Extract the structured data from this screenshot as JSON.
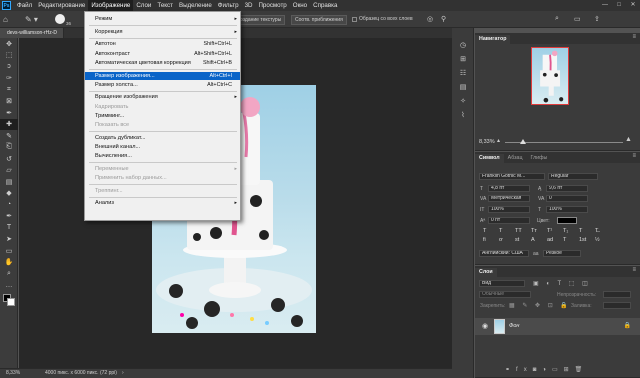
{
  "menubar": {
    "logo": "Ps",
    "items": [
      "Файл",
      "Редактирование",
      "Изображение",
      "Слои",
      "Текст",
      "Выделение",
      "Фильтр",
      "3D",
      "Просмотр",
      "Окно",
      "Справка"
    ],
    "active_index": 2,
    "window_controls": [
      "—",
      "□",
      "✕"
    ]
  },
  "options_bar": {
    "brush_size": "36",
    "texture_btn": "оздание текстуры",
    "proximity_btn": "Соотв. приближения",
    "sample_all_label": "Образец со всех слоев"
  },
  "document": {
    "tab_title": "devs-williamson-rHz-D"
  },
  "status": {
    "zoom": "8,33%",
    "doc_info": "4000 пикс. x 6000 пикс. (72 ppi)"
  },
  "image_menu": {
    "items": [
      {
        "label": "Режим",
        "shortcut": "",
        "submenu": true,
        "disabled": false,
        "highlight": false
      },
      {
        "label": "Коррекция",
        "shortcut": "",
        "submenu": true,
        "disabled": false,
        "highlight": false
      },
      {
        "label": "Автотон",
        "shortcut": "Shift+Ctrl+L",
        "submenu": false,
        "disabled": false,
        "highlight": false
      },
      {
        "label": "Автоконтраст",
        "shortcut": "Alt+Shift+Ctrl+L",
        "submenu": false,
        "disabled": false,
        "highlight": false
      },
      {
        "label": "Автоматическая цветовая коррекция",
        "shortcut": "Shift+Ctrl+B",
        "submenu": false,
        "disabled": false,
        "highlight": false
      },
      {
        "label": "Размер изображения...",
        "shortcut": "Alt+Ctrl+I",
        "submenu": false,
        "disabled": false,
        "highlight": true
      },
      {
        "label": "Размер холста...",
        "shortcut": "Alt+Ctrl+C",
        "submenu": false,
        "disabled": false,
        "highlight": false
      },
      {
        "label": "Вращение изображения",
        "shortcut": "",
        "submenu": true,
        "disabled": false,
        "highlight": false
      },
      {
        "label": "Кадрировать",
        "shortcut": "",
        "submenu": false,
        "disabled": true,
        "highlight": false
      },
      {
        "label": "Тримминг...",
        "shortcut": "",
        "submenu": false,
        "disabled": false,
        "highlight": false
      },
      {
        "label": "Показать все",
        "shortcut": "",
        "submenu": false,
        "disabled": true,
        "highlight": false
      },
      {
        "label": "Создать дубликат...",
        "shortcut": "",
        "submenu": false,
        "disabled": false,
        "highlight": false
      },
      {
        "label": "Внешний канал...",
        "shortcut": "",
        "submenu": false,
        "disabled": false,
        "highlight": false
      },
      {
        "label": "Вычисления...",
        "shortcut": "",
        "submenu": false,
        "disabled": false,
        "highlight": false
      },
      {
        "label": "Переменные",
        "shortcut": "",
        "submenu": true,
        "disabled": true,
        "highlight": false
      },
      {
        "label": "Применить набор данных...",
        "shortcut": "",
        "submenu": false,
        "disabled": true,
        "highlight": false
      },
      {
        "label": "Треппинг...",
        "shortcut": "",
        "submenu": false,
        "disabled": true,
        "highlight": false
      },
      {
        "label": "Анализ",
        "shortcut": "",
        "submenu": true,
        "disabled": false,
        "highlight": false
      }
    ]
  },
  "navigator": {
    "title": "Навигатор",
    "zoom": "8,33%"
  },
  "character": {
    "tabs": [
      "Символ",
      "Абзац",
      "Глифы"
    ],
    "font_family": "Franklin Gothic M...",
    "font_style": "Regular",
    "font_size": "4,8 пт",
    "leading": "9,6 пт",
    "kerning": "Метрическая",
    "tracking": "0",
    "vscale": "100%",
    "hscale": "100%",
    "baseline": "0 пт",
    "color_label": "Цвет:",
    "language": "Английский: США",
    "aa": "Резкое",
    "fmt_glyphs": [
      "T",
      "T",
      "TT",
      "Tт",
      "T¹",
      "T₁",
      "T",
      "T̶"
    ],
    "ot_glyphs": [
      "fi",
      "ơ",
      "st",
      "A",
      "ad",
      "T",
      "1st",
      "½"
    ]
  },
  "layers": {
    "tab": "Слои",
    "search": "Вид",
    "blend": "Обычные",
    "opacity_label": "Непрозрачность:",
    "lock_label": "Закрепить:",
    "fill_label": "Заливка:",
    "layer_name": "Фон"
  },
  "tools": [
    "move",
    "marquee",
    "lasso",
    "quick-select",
    "crop",
    "frame",
    "eyedropper",
    "healing",
    "brush",
    "stamp",
    "history-brush",
    "eraser",
    "gradient",
    "blur",
    "dodge",
    "pen",
    "type",
    "path-select",
    "shape",
    "hand",
    "zoom",
    "more"
  ],
  "colors": {
    "accent": "#0a64c8",
    "app_bg": "#535353",
    "panel_bg": "#3b3b3b",
    "canvas_bg": "#282828",
    "nav_frame": "#e03c3c"
  }
}
